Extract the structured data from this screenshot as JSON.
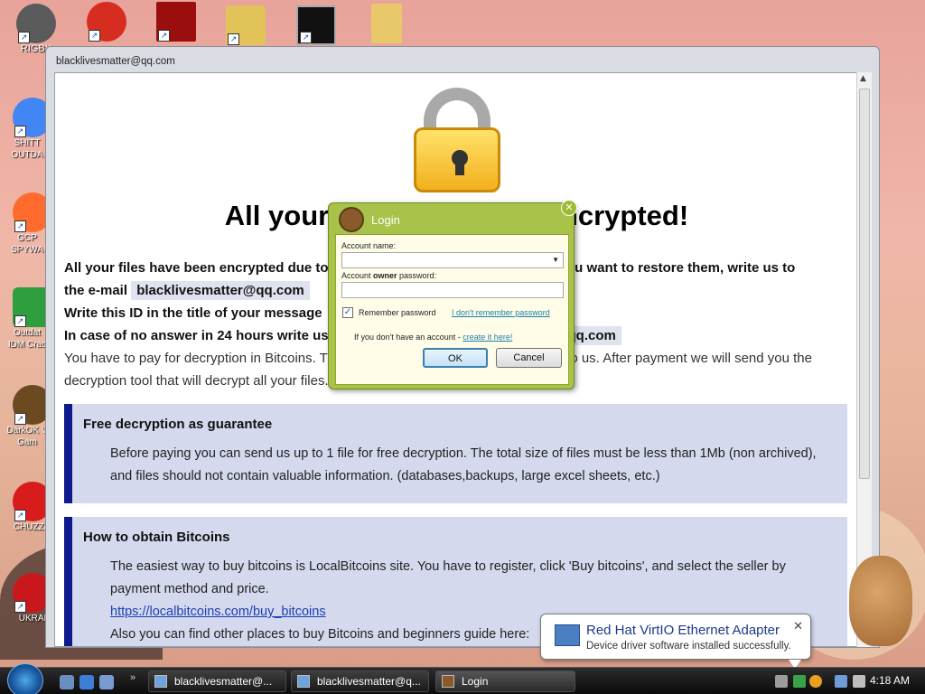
{
  "desktop": {
    "icons": [
      {
        "label": "RIGBY",
        "color": "#5a5a5a"
      },
      {
        "label": "",
        "color": "#d62d20"
      },
      {
        "label": "",
        "color": "#9a0e0e"
      },
      {
        "label": "",
        "color": "#e2c35a"
      },
      {
        "label": "",
        "color": "#111111"
      },
      {
        "label": "",
        "color": "#e8c86a"
      },
      {
        "label": "SHITT OUTDA",
        "color": "#4285f4"
      },
      {
        "label": "GCP SPYWA",
        "color": "#ff6b2c"
      },
      {
        "label": "Outdat IDM Crac",
        "color": "#2f9e3f"
      },
      {
        "label": "DarkOK V Gam",
        "color": "#6b4a21"
      },
      {
        "label": "CHUZZLI",
        "color": "#d81b1b"
      },
      {
        "label": "UKRAI",
        "color": "#c9181b"
      }
    ]
  },
  "window": {
    "title": "blacklivesmatter@qq.com",
    "headline": "All your files have been encrypted!",
    "para1_a": "All your files have been encrypted due to a security problem with your PC. If you want to restore them, write us to",
    "para1_b": "the e-mail",
    "email": "blacklivesmatter@qq.com",
    "para2": "Write this ID in the title of your message",
    "para3_a": "In case of no answer in 24 hours write us to theese e-mail:",
    "para3_email": "blacklivesmatter@qq.com",
    "para4_a": "You have to pay for decryption in Bitcoins. The price depends on how fast you write to us. After payment we will send you the",
    "para4_b": "decryption tool that will decrypt all your files.",
    "box1": {
      "title": "Free decryption as guarantee",
      "text": "Before paying you can send us up to 1 file for free decryption. The total size of files must be less than 1Mb (non archived), and files should not contain valuable information. (databases,backups, large excel sheets, etc.)"
    },
    "box2": {
      "title": "How to obtain Bitcoins",
      "text": "The easiest way to buy bitcoins is LocalBitcoins site. You have to register, click 'Buy bitcoins', and select the seller by payment method and price.",
      "link": "https://localbitcoins.com/buy_bitcoins",
      "text2": "Also you can find other places to buy Bitcoins and beginners guide here:"
    }
  },
  "login": {
    "title": "Login",
    "account_name_label": "Account name:",
    "password_label_pre": "Account ",
    "password_label_bold": "owner",
    "password_label_post": " password:",
    "remember_label": "Remember password",
    "forgot_link": "I don't remember password",
    "create_text": "If you don't have an account - ",
    "create_link": "create it here!",
    "ok_label": "OK",
    "cancel_label": "Cancel",
    "remember_checked": true
  },
  "notification": {
    "title": "Red Hat VirtIO Ethernet Adapter",
    "message": "Device driver software installed successfully."
  },
  "taskbar": {
    "buttons": [
      {
        "label": "blacklivesmatter@..."
      },
      {
        "label": "blacklivesmatter@q..."
      },
      {
        "label": "Login"
      }
    ],
    "clock": "4:18 AM"
  },
  "colors": {
    "dialog_green": "#a8c24a",
    "box_bg": "#d5d9ee",
    "box_accent": "#0c1a8c"
  }
}
